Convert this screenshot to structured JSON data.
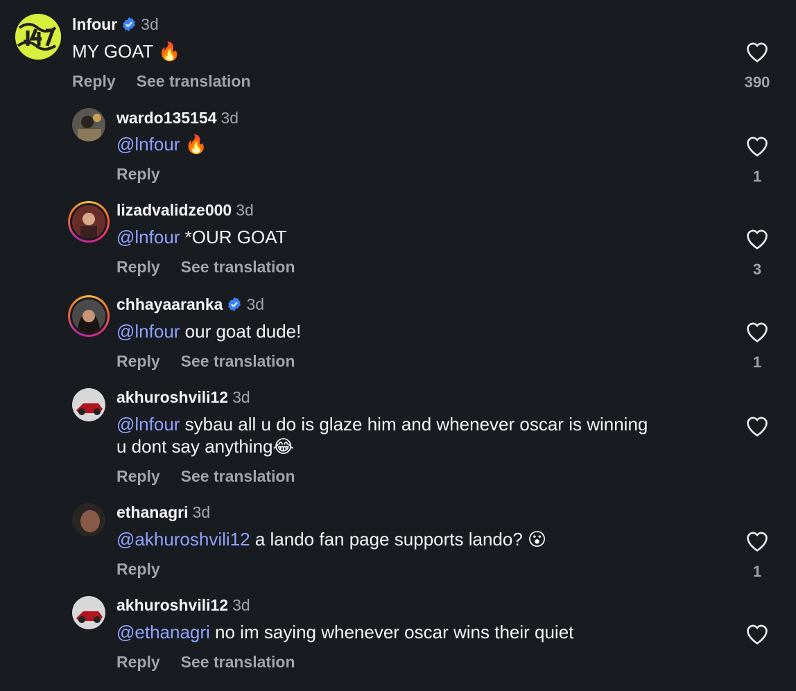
{
  "labels": {
    "reply": "Reply",
    "see_translation": "See translation"
  },
  "comments": [
    {
      "username": "lnfour",
      "time": "3d",
      "text": "MY GOAT",
      "emoji": "🔥",
      "likes": "390"
    },
    {
      "username": "wardo135154",
      "time": "3d",
      "mention": "@lnfour",
      "text": "",
      "emoji": "🔥",
      "likes": "1"
    },
    {
      "username": "lizadvalidze000",
      "time": "3d",
      "mention": "@lnfour",
      "text": " *OUR GOAT",
      "likes": "3"
    },
    {
      "username": "chhayaaranka",
      "time": "3d",
      "mention": "@lnfour",
      "text": " our goat dude!",
      "likes": "1"
    },
    {
      "username": "akhuroshvili12",
      "time": "3d",
      "mention": "@lnfour",
      "text": " sybau all u do is glaze him and whenever oscar is winning",
      "text2": "u dont say anything",
      "emoji": "😂"
    },
    {
      "username": "ethanagri",
      "time": "3d",
      "mention": "@akhuroshvili12",
      "text": " a lando fan page supports lando?",
      "emoji": "😮",
      "likes": "1"
    },
    {
      "username": "akhuroshvili12",
      "time": "3d",
      "mention": "@ethanagri",
      "text": " no im saying whenever oscar wins their quiet"
    }
  ],
  "colors": {
    "background": "#181b20",
    "mention": "#8fa2ff",
    "muted": "#a0a4ab",
    "verified": "#3b82f6"
  },
  "icons": {
    "like": "heart-icon",
    "verified": "verified-badge-icon"
  }
}
